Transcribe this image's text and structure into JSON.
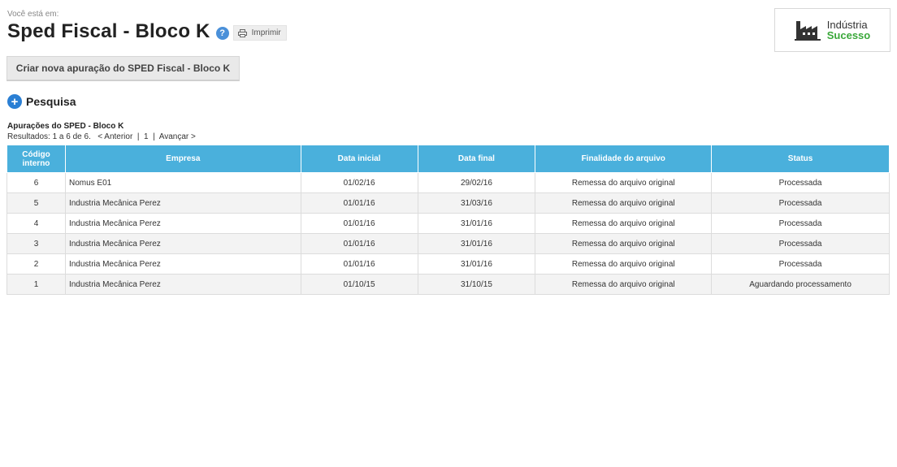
{
  "breadcrumb": "Você está em:",
  "page_title": "Sped Fiscal - Bloco K",
  "help_icon": "?",
  "print_label": "Imprimir",
  "logo": {
    "line1": "Indústria",
    "line2": "Sucesso",
    "accent": "#3aa83a"
  },
  "create_button_label": "Criar nova apuração do SPED Fiscal - Bloco K",
  "search_section_label": "Pesquisa",
  "list_title": "Apurações do SPED - Bloco K",
  "pagination": {
    "results_text": "Resultados: 1 a 6 de 6.",
    "prev_label": "< Anterior",
    "page_label": "1",
    "next_label": "Avançar >"
  },
  "table": {
    "headers": {
      "codigo": "Código interno",
      "empresa": "Empresa",
      "data_inicial": "Data inicial",
      "data_final": "Data final",
      "finalidade": "Finalidade do arquivo",
      "status": "Status"
    },
    "rows": [
      {
        "codigo": "6",
        "empresa": "Nomus E01",
        "data_inicial": "01/02/16",
        "data_final": "29/02/16",
        "finalidade": "Remessa do arquivo original",
        "status": "Processada"
      },
      {
        "codigo": "5",
        "empresa": "Industria Mecânica Perez",
        "data_inicial": "01/01/16",
        "data_final": "31/03/16",
        "finalidade": "Remessa do arquivo original",
        "status": "Processada"
      },
      {
        "codigo": "4",
        "empresa": "Industria Mecânica Perez",
        "data_inicial": "01/01/16",
        "data_final": "31/01/16",
        "finalidade": "Remessa do arquivo original",
        "status": "Processada"
      },
      {
        "codigo": "3",
        "empresa": "Industria Mecânica Perez",
        "data_inicial": "01/01/16",
        "data_final": "31/01/16",
        "finalidade": "Remessa do arquivo original",
        "status": "Processada"
      },
      {
        "codigo": "2",
        "empresa": "Industria Mecânica Perez",
        "data_inicial": "01/01/16",
        "data_final": "31/01/16",
        "finalidade": "Remessa do arquivo original",
        "status": "Processada"
      },
      {
        "codigo": "1",
        "empresa": "Industria Mecânica Perez",
        "data_inicial": "01/10/15",
        "data_final": "31/10/15",
        "finalidade": "Remessa do arquivo original",
        "status": "Aguardando processamento"
      }
    ]
  },
  "colors": {
    "header_bg": "#4ab0dc",
    "help_icon": "#4a90d9",
    "plus_icon": "#2a7fd4"
  }
}
